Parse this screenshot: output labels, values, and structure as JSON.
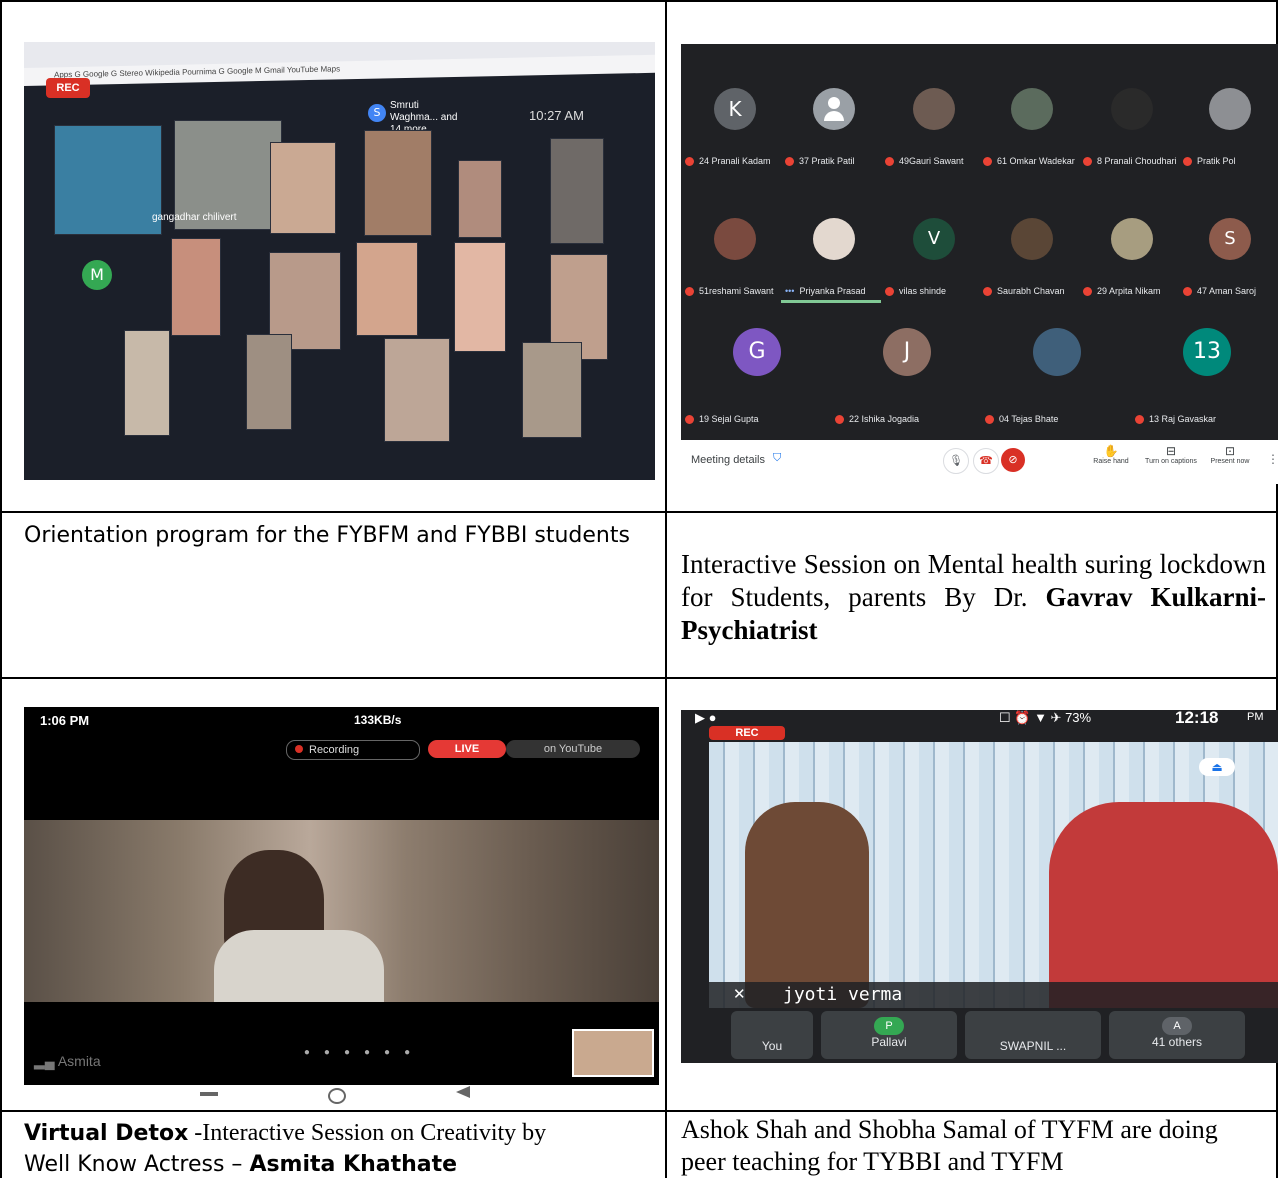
{
  "captions": {
    "c1": "Orientation program for the FYBFM and FYBBI students",
    "c2_text": "Interactive Session on Mental health suring lockdown for  Students, parents By Dr. ",
    "c2_bold": "Gavrav Kulkarni-Psychiatrist",
    "c3_bold1": "Virtual Detox",
    "c3_text": " -Interactive Session on Creativity by ",
    "c3_text2": "Well Know Actress – ",
    "c3_bold2": "Asmita Khathate",
    "c4": "Ashok Shah and Shobha Samal of TYFM are doing peer teaching for TYBBI and TYFM"
  },
  "photo1": {
    "rec": "REC",
    "tabs": "Apps  G Google  G Stereo  Wikipedia  Pournima  G Google  M Gmail  YouTube  Maps",
    "presenter": "Smruti Waghma... and 14 more",
    "presenter_initial": "S",
    "time": "10:27 AM",
    "avatar_m": "M",
    "name_label": "gangadhar chilivert"
  },
  "photo2": {
    "row1": [
      "24 Pranali Kadam",
      "37 Pratik Patil",
      "49Gauri Sawant",
      "61 Omkar Wadekar",
      "8 Pranali Choudhari",
      "Pratik Pol"
    ],
    "row1_initials": [
      "K",
      "",
      "",
      "",
      "",
      ""
    ],
    "row2": [
      "51reshami Sawant",
      "Priyanka Prasad",
      "vilas shinde",
      "Saurabh Chavan",
      "29 Arpita Nikam",
      "47 Aman Saroj"
    ],
    "row2_initials": [
      "",
      "",
      "V",
      "",
      "",
      "S"
    ],
    "row3": [
      "19 Sejal Gupta",
      "22 Ishika Jogadia",
      "04 Tejas Bhate",
      "13 Raj Gavaskar"
    ],
    "row3_initials": [
      "G",
      "J",
      "",
      "13"
    ],
    "meeting_details": "Meeting details",
    "raise_hand": "Raise hand",
    "captions": "Turn on captions",
    "present": "Present now"
  },
  "photo3": {
    "time": "1:06 PM",
    "net": "133KB/s",
    "recording": "Recording",
    "live": "LIVE",
    "youtube": "on YouTube",
    "name": "Asmita"
  },
  "photo4": {
    "rec": "REC",
    "time": "12:18",
    "ampm": "PM",
    "battery": "73%",
    "speaker": "jyoti verma",
    "chips": [
      "You",
      "Pallavi",
      "SWAPNIL ...",
      "41 others"
    ],
    "chip_initials": [
      "",
      "P",
      "",
      "A"
    ]
  },
  "colors": {
    "rec_red": "#d93025",
    "meet_bg": "#202124",
    "avatar_green": "#188038",
    "avatar_purple": "#7e57c2",
    "avatar_brown": "#8d6e63",
    "avatar_teal": "#00897b",
    "avatar_darkgreen": "#1e4d3a",
    "avatar_grey": "#5f6368"
  }
}
